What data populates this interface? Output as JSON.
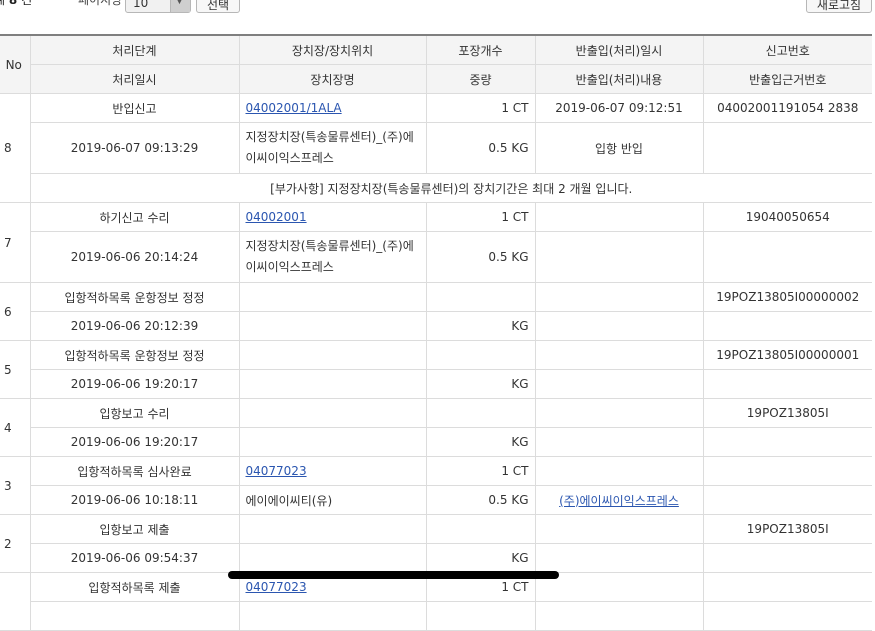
{
  "toolbar": {
    "total_prefix": "계",
    "total_count": "8",
    "total_suffix": "건",
    "per_page_label": "페이지당",
    "per_page_value": "10",
    "select_button": "선택",
    "refresh_button": "새로고침"
  },
  "table": {
    "header_no": "No",
    "header_row1": [
      "처리단계",
      "장치장/장치위치",
      "포장개수",
      "반출입(처리)일시",
      "신고번호"
    ],
    "header_row2": [
      "처리일시",
      "장치장명",
      "중량",
      "반출입(처리)내용",
      "반출입근거번호"
    ],
    "rows": [
      {
        "no": "8",
        "stage": "반입신고",
        "location": "04002001/1ALA",
        "count": "1 CT",
        "io_datetime": "2019-06-07 09:12:51",
        "decl_no": "04002001191054 2838",
        "proc_datetime": "2019-06-07 09:13:29",
        "warehouse": "지정장치장(특송물류센터)_(주)에이씨이익스프레스",
        "weight": "0.5 KG",
        "io_content": "입항 반입",
        "basis_no": "",
        "note": "[부가사항] 지정장치장(특송물류센터)의 장치기간은 최대 2 개월 입니다."
      },
      {
        "no": "7",
        "stage": "하기신고 수리",
        "location": "04002001",
        "count": "1 CT",
        "io_datetime": "",
        "decl_no": "19040050654",
        "proc_datetime": "2019-06-06 20:14:24",
        "warehouse": "지정장치장(특송물류센터)_(주)에이씨이익스프레스",
        "weight": "0.5 KG",
        "io_content": "",
        "basis_no": ""
      },
      {
        "no": "6",
        "stage": "입항적하목록 운항정보 정정",
        "location": "",
        "count": "",
        "io_datetime": "",
        "decl_no": "19POZ13805I00000002",
        "proc_datetime": "2019-06-06 20:12:39",
        "warehouse": "",
        "weight": "KG",
        "io_content": "",
        "basis_no": ""
      },
      {
        "no": "5",
        "stage": "입항적하목록 운항정보 정정",
        "location": "",
        "count": "",
        "io_datetime": "",
        "decl_no": "19POZ13805I00000001",
        "proc_datetime": "2019-06-06 19:20:17",
        "warehouse": "",
        "weight": "KG",
        "io_content": "",
        "basis_no": ""
      },
      {
        "no": "4",
        "stage": "입항보고 수리",
        "location": "",
        "count": "",
        "io_datetime": "",
        "decl_no": "19POZ13805I",
        "proc_datetime": "2019-06-06 19:20:17",
        "warehouse": "",
        "weight": "KG",
        "io_content": "",
        "basis_no": ""
      },
      {
        "no": "3",
        "stage": "입항적하목록 심사완료",
        "location": "04077023",
        "count": "1 CT",
        "io_datetime": "",
        "decl_no": "",
        "proc_datetime": "2019-06-06 10:18:11",
        "warehouse": "에이에이씨티(유)",
        "weight": "0.5 KG",
        "io_content": "(주)에이씨이익스프레스",
        "basis_no": ""
      },
      {
        "no": "2",
        "stage": "입항보고 제출",
        "location": "",
        "count": "",
        "io_datetime": "",
        "decl_no": "19POZ13805I",
        "proc_datetime": "2019-06-06 09:54:37",
        "warehouse": "",
        "weight": "KG",
        "io_content": "",
        "basis_no": ""
      },
      {
        "no": "",
        "stage": "입항적하목록 제출",
        "location": "04077023",
        "count": "1 CT",
        "io_datetime": "",
        "decl_no": "",
        "proc_datetime": "",
        "warehouse": "",
        "weight": "",
        "io_content": "",
        "basis_no": ""
      }
    ]
  }
}
